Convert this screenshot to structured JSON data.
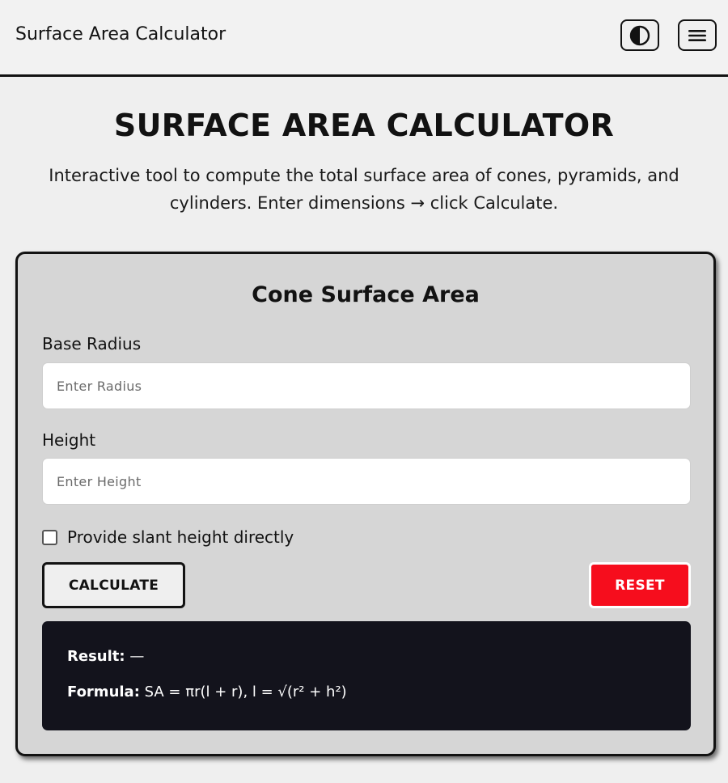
{
  "navbar": {
    "brand": "Surface Area Calculator",
    "theme_toggle_icon": "contrast-icon",
    "menu_icon": "hamburger-menu-icon"
  },
  "header": {
    "title": "SURFACE AREA CALCULATOR",
    "intro": "Interactive tool to compute the total surface area of cones, pyramids, and cylinders. Enter dimensions → click Calculate."
  },
  "card": {
    "title": "Cone Surface Area",
    "radius": {
      "label": "Base Radius",
      "value": "",
      "placeholder": "Enter Radius"
    },
    "height": {
      "label": "Height",
      "value": "",
      "placeholder": "Enter Height"
    },
    "slant_checkbox": {
      "label": "Provide slant height directly",
      "checked": false
    },
    "calculate_label": "CALCULATE",
    "reset_label": "RESET",
    "result": {
      "result_label": "Result:",
      "result_value": "—",
      "formula_label": "Formula:",
      "formula_value": "SA = πr(l + r), l = √(r² + h²)"
    }
  },
  "colors": {
    "background": "#efefef",
    "card_bg": "#d6d6d6",
    "accent_dark": "#121212",
    "reset_red": "#f60d1d",
    "result_bg": "#13131c"
  }
}
